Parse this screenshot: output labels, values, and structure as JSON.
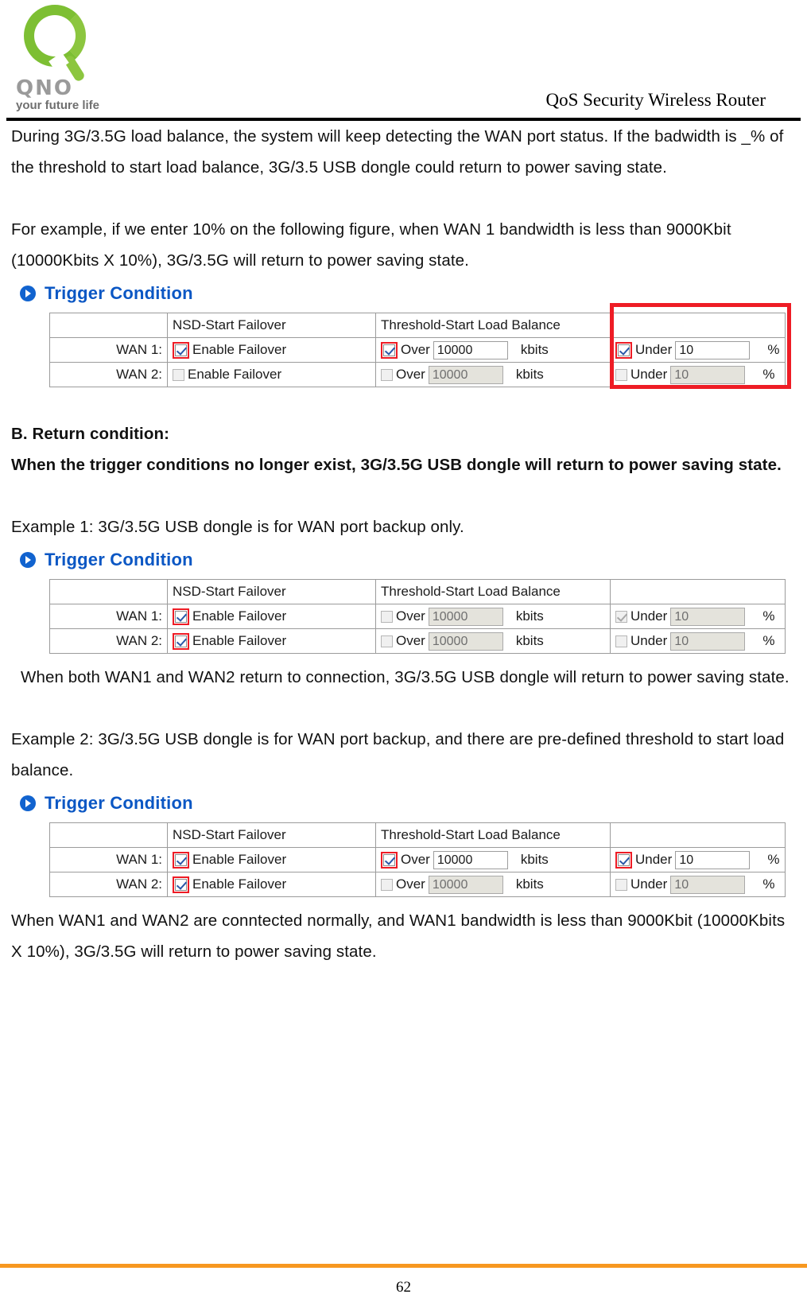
{
  "header": {
    "logo_word": "QNO",
    "logo_tagline": "your future life",
    "title": "QoS Security Wireless Router"
  },
  "body": {
    "para1": "During 3G/3.5G load balance, the system will keep detecting the WAN port status.    If the badwidth is _% of the threshold to start load balance, 3G/3.5 USB dongle could return to power saving state.",
    "para2": "For example, if we enter 10% on the following figure, when WAN 1 bandwidth is less than 9000Kbit (10000Kbits X 10%), 3G/3.5G will return to power saving state.",
    "heading_b": "B. Return condition:",
    "para3": "When the trigger conditions no longer exist, 3G/3.5G USB dongle will return to power saving state.",
    "example1": "Example 1: 3G/3.5G USB dongle is for WAN port backup only.",
    "para4": "When both WAN1 and WAN2 return to connection, 3G/3.5G USB dongle will return to power saving state.",
    "example2": "Example 2: 3G/3.5G USB dongle is for WAN port backup, and there are pre-defined threshold to start load balance.",
    "para5": "When WAN1 and WAN2 are conntected normally, and WAN1 bandwidth is less than 9000Kbit (10000Kbits X 10%), 3G/3.5G will return to power saving state."
  },
  "figures": [
    {
      "id": "figure-1",
      "panel_title": "Trigger Condition",
      "icon": "arrow-circle-icon",
      "columns": [
        "",
        "NSD-Start Failover",
        "Threshold-Start Load Balance",
        ""
      ],
      "highlight": {
        "present": true,
        "color": "#ee1c25",
        "target": "percent-column"
      },
      "rows": [
        {
          "label": "WAN 1:",
          "failover": {
            "label": "Enable Failover",
            "checked": true,
            "disabled": false,
            "highlighted": true
          },
          "threshold": {
            "label": "Over",
            "checked": true,
            "disabled": false,
            "highlighted": true,
            "value": "10000",
            "unit": "kbits"
          },
          "percent": {
            "label": "Under",
            "checked": true,
            "disabled": false,
            "highlighted": true,
            "value": "10",
            "unit": "%"
          }
        },
        {
          "label": "WAN 2:",
          "failover": {
            "label": "Enable Failover",
            "checked": false,
            "disabled": true,
            "highlighted": false
          },
          "threshold": {
            "label": "Over",
            "checked": false,
            "disabled": true,
            "highlighted": false,
            "value": "10000",
            "unit": "kbits"
          },
          "percent": {
            "label": "Under",
            "checked": false,
            "disabled": true,
            "highlighted": false,
            "value": "10",
            "unit": "%"
          }
        }
      ]
    },
    {
      "id": "figure-2",
      "panel_title": "Trigger Condition",
      "icon": "arrow-circle-icon",
      "columns": [
        "",
        "NSD-Start Failover",
        "Threshold-Start Load Balance",
        ""
      ],
      "highlight": {
        "present": false,
        "color": "#ee1c25",
        "target": ""
      },
      "rows": [
        {
          "label": "WAN 1:",
          "failover": {
            "label": "Enable Failover",
            "checked": true,
            "disabled": false,
            "highlighted": true
          },
          "threshold": {
            "label": "Over",
            "checked": false,
            "disabled": true,
            "highlighted": false,
            "value": "10000",
            "unit": "kbits"
          },
          "percent": {
            "label": "Under",
            "checked": true,
            "disabled": true,
            "highlighted": false,
            "value": "10",
            "unit": "%"
          }
        },
        {
          "label": "WAN 2:",
          "failover": {
            "label": "Enable Failover",
            "checked": true,
            "disabled": false,
            "highlighted": true
          },
          "threshold": {
            "label": "Over",
            "checked": false,
            "disabled": true,
            "highlighted": false,
            "value": "10000",
            "unit": "kbits"
          },
          "percent": {
            "label": "Under",
            "checked": false,
            "disabled": true,
            "highlighted": false,
            "value": "10",
            "unit": "%"
          }
        }
      ]
    },
    {
      "id": "figure-3",
      "panel_title": "Trigger Condition",
      "icon": "arrow-circle-icon",
      "columns": [
        "",
        "NSD-Start Failover",
        "Threshold-Start Load Balance",
        ""
      ],
      "highlight": {
        "present": false,
        "color": "#ee1c25",
        "target": ""
      },
      "rows": [
        {
          "label": "WAN 1:",
          "failover": {
            "label": "Enable Failover",
            "checked": true,
            "disabled": false,
            "highlighted": true
          },
          "threshold": {
            "label": "Over",
            "checked": true,
            "disabled": false,
            "highlighted": true,
            "value": "10000",
            "unit": "kbits"
          },
          "percent": {
            "label": "Under",
            "checked": true,
            "disabled": false,
            "highlighted": true,
            "value": "10",
            "unit": "%"
          }
        },
        {
          "label": "WAN 2:",
          "failover": {
            "label": "Enable Failover",
            "checked": true,
            "disabled": false,
            "highlighted": true
          },
          "threshold": {
            "label": "Over",
            "checked": false,
            "disabled": true,
            "highlighted": false,
            "value": "10000",
            "unit": "kbits"
          },
          "percent": {
            "label": "Under",
            "checked": false,
            "disabled": true,
            "highlighted": false,
            "value": "10",
            "unit": "%"
          }
        }
      ]
    }
  ],
  "footer": {
    "page_number": "62",
    "rule_color": "#f79820"
  }
}
